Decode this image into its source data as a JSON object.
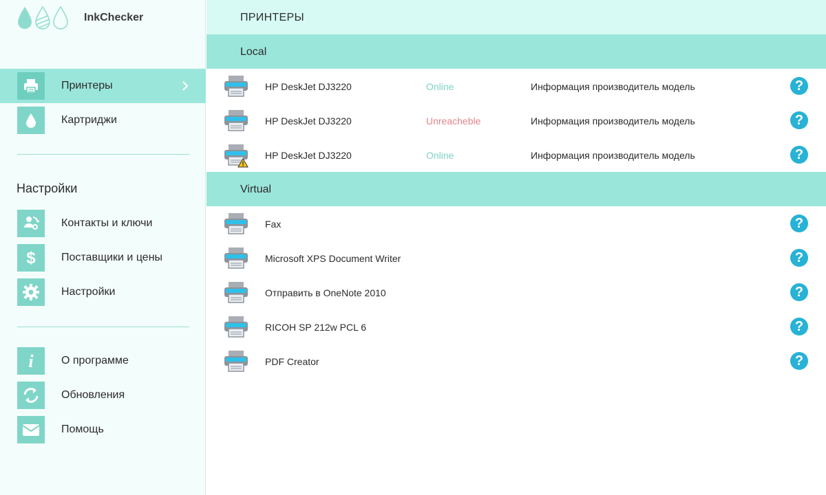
{
  "app": {
    "name": "InkChecker"
  },
  "colors": {
    "accent": "#9be6db",
    "tile": "#7fd6c8",
    "online": "#7ed3c6",
    "offline": "#e2848a",
    "help": "#27b2d6"
  },
  "sidebar": {
    "nav": [
      {
        "label": "Принтеры",
        "icon": "printer-icon"
      },
      {
        "label": "Картриджи",
        "icon": "ink-drop-icon"
      }
    ],
    "settings_title": "Настройки",
    "settings": [
      {
        "label": "Контакты и ключи",
        "icon": "contacts-icon"
      },
      {
        "label": "Поставщики и цены",
        "icon": "dollar-icon"
      },
      {
        "label": "Настройки",
        "icon": "gear-icon"
      }
    ],
    "about": [
      {
        "label": "О программе",
        "icon": "info-icon"
      },
      {
        "label": "Обновления",
        "icon": "update-icon"
      },
      {
        "label": "Помощь",
        "icon": "envelope-icon"
      }
    ]
  },
  "main": {
    "title": "ПРИНТЕРЫ",
    "groups": [
      {
        "label": "Local",
        "printers": [
          {
            "name": "HP DeskJet DJ3220",
            "status": "Online",
            "info": "Информация производитель модель",
            "warning": false
          },
          {
            "name": "HP DeskJet DJ3220",
            "status": "Unreacheble",
            "info": "Информация производитель модель",
            "warning": false
          },
          {
            "name": "HP DeskJet DJ3220",
            "status": "Online",
            "info": "Информация производитель модель",
            "warning": true
          }
        ]
      },
      {
        "label": "Virtual",
        "printers": [
          {
            "name": "Fax"
          },
          {
            "name": "Microsoft XPS Document Writer"
          },
          {
            "name": "Отправить в OneNote 2010"
          },
          {
            "name": "RICOH SP 212w PCL 6"
          },
          {
            "name": "PDF Creator"
          }
        ]
      }
    ],
    "help_glyph": "?"
  }
}
